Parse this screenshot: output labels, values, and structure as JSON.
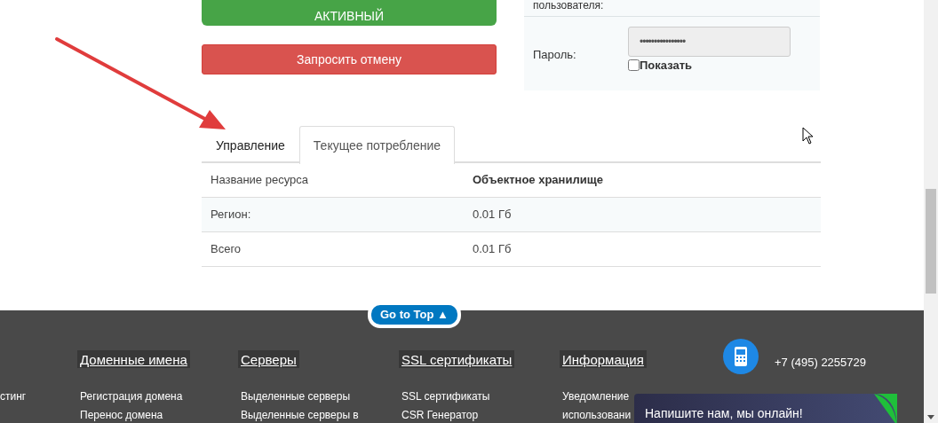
{
  "service": {
    "status": "АКТИВНЫЙ",
    "cancel_button": "Запросить отмену"
  },
  "credentials": {
    "username_label": "пользователя:",
    "password_label": "Пароль:",
    "password_value": "••••••••••••••••",
    "show_label": "Показать",
    "show_checked": false
  },
  "tabs": [
    {
      "label": "Управление",
      "selected": false
    },
    {
      "label": "Текущее потребление",
      "selected": true
    }
  ],
  "table": {
    "rows": [
      {
        "name": "Название ресурса",
        "value": "Объектное хранилище",
        "kind": "header"
      },
      {
        "name": "Регион:",
        "value": "0.01 Гб",
        "kind": "data"
      },
      {
        "name": "Всего",
        "value": "0.01 Гб",
        "kind": "data"
      }
    ]
  },
  "go_to_top": "Go to Top ▲",
  "footer": {
    "columns": [
      {
        "items": [
          "стинг"
        ]
      },
      {
        "heading": "Доменные имена",
        "items": [
          "Регистрация домена",
          "Перенос домена"
        ]
      },
      {
        "heading": "Серверы",
        "items": [
          "Выделенные серверы",
          "Выделенные серверы в"
        ]
      },
      {
        "heading": "SSL сертификаты",
        "items": [
          "SSL сертификаты",
          "CSR Генератор"
        ]
      },
      {
        "heading": "Информация",
        "items": [
          "Уведомление",
          "использовани"
        ]
      }
    ],
    "phone": "+7 (495) 2255729"
  },
  "chat": {
    "text": "Напишите нам, мы онлайн!"
  }
}
